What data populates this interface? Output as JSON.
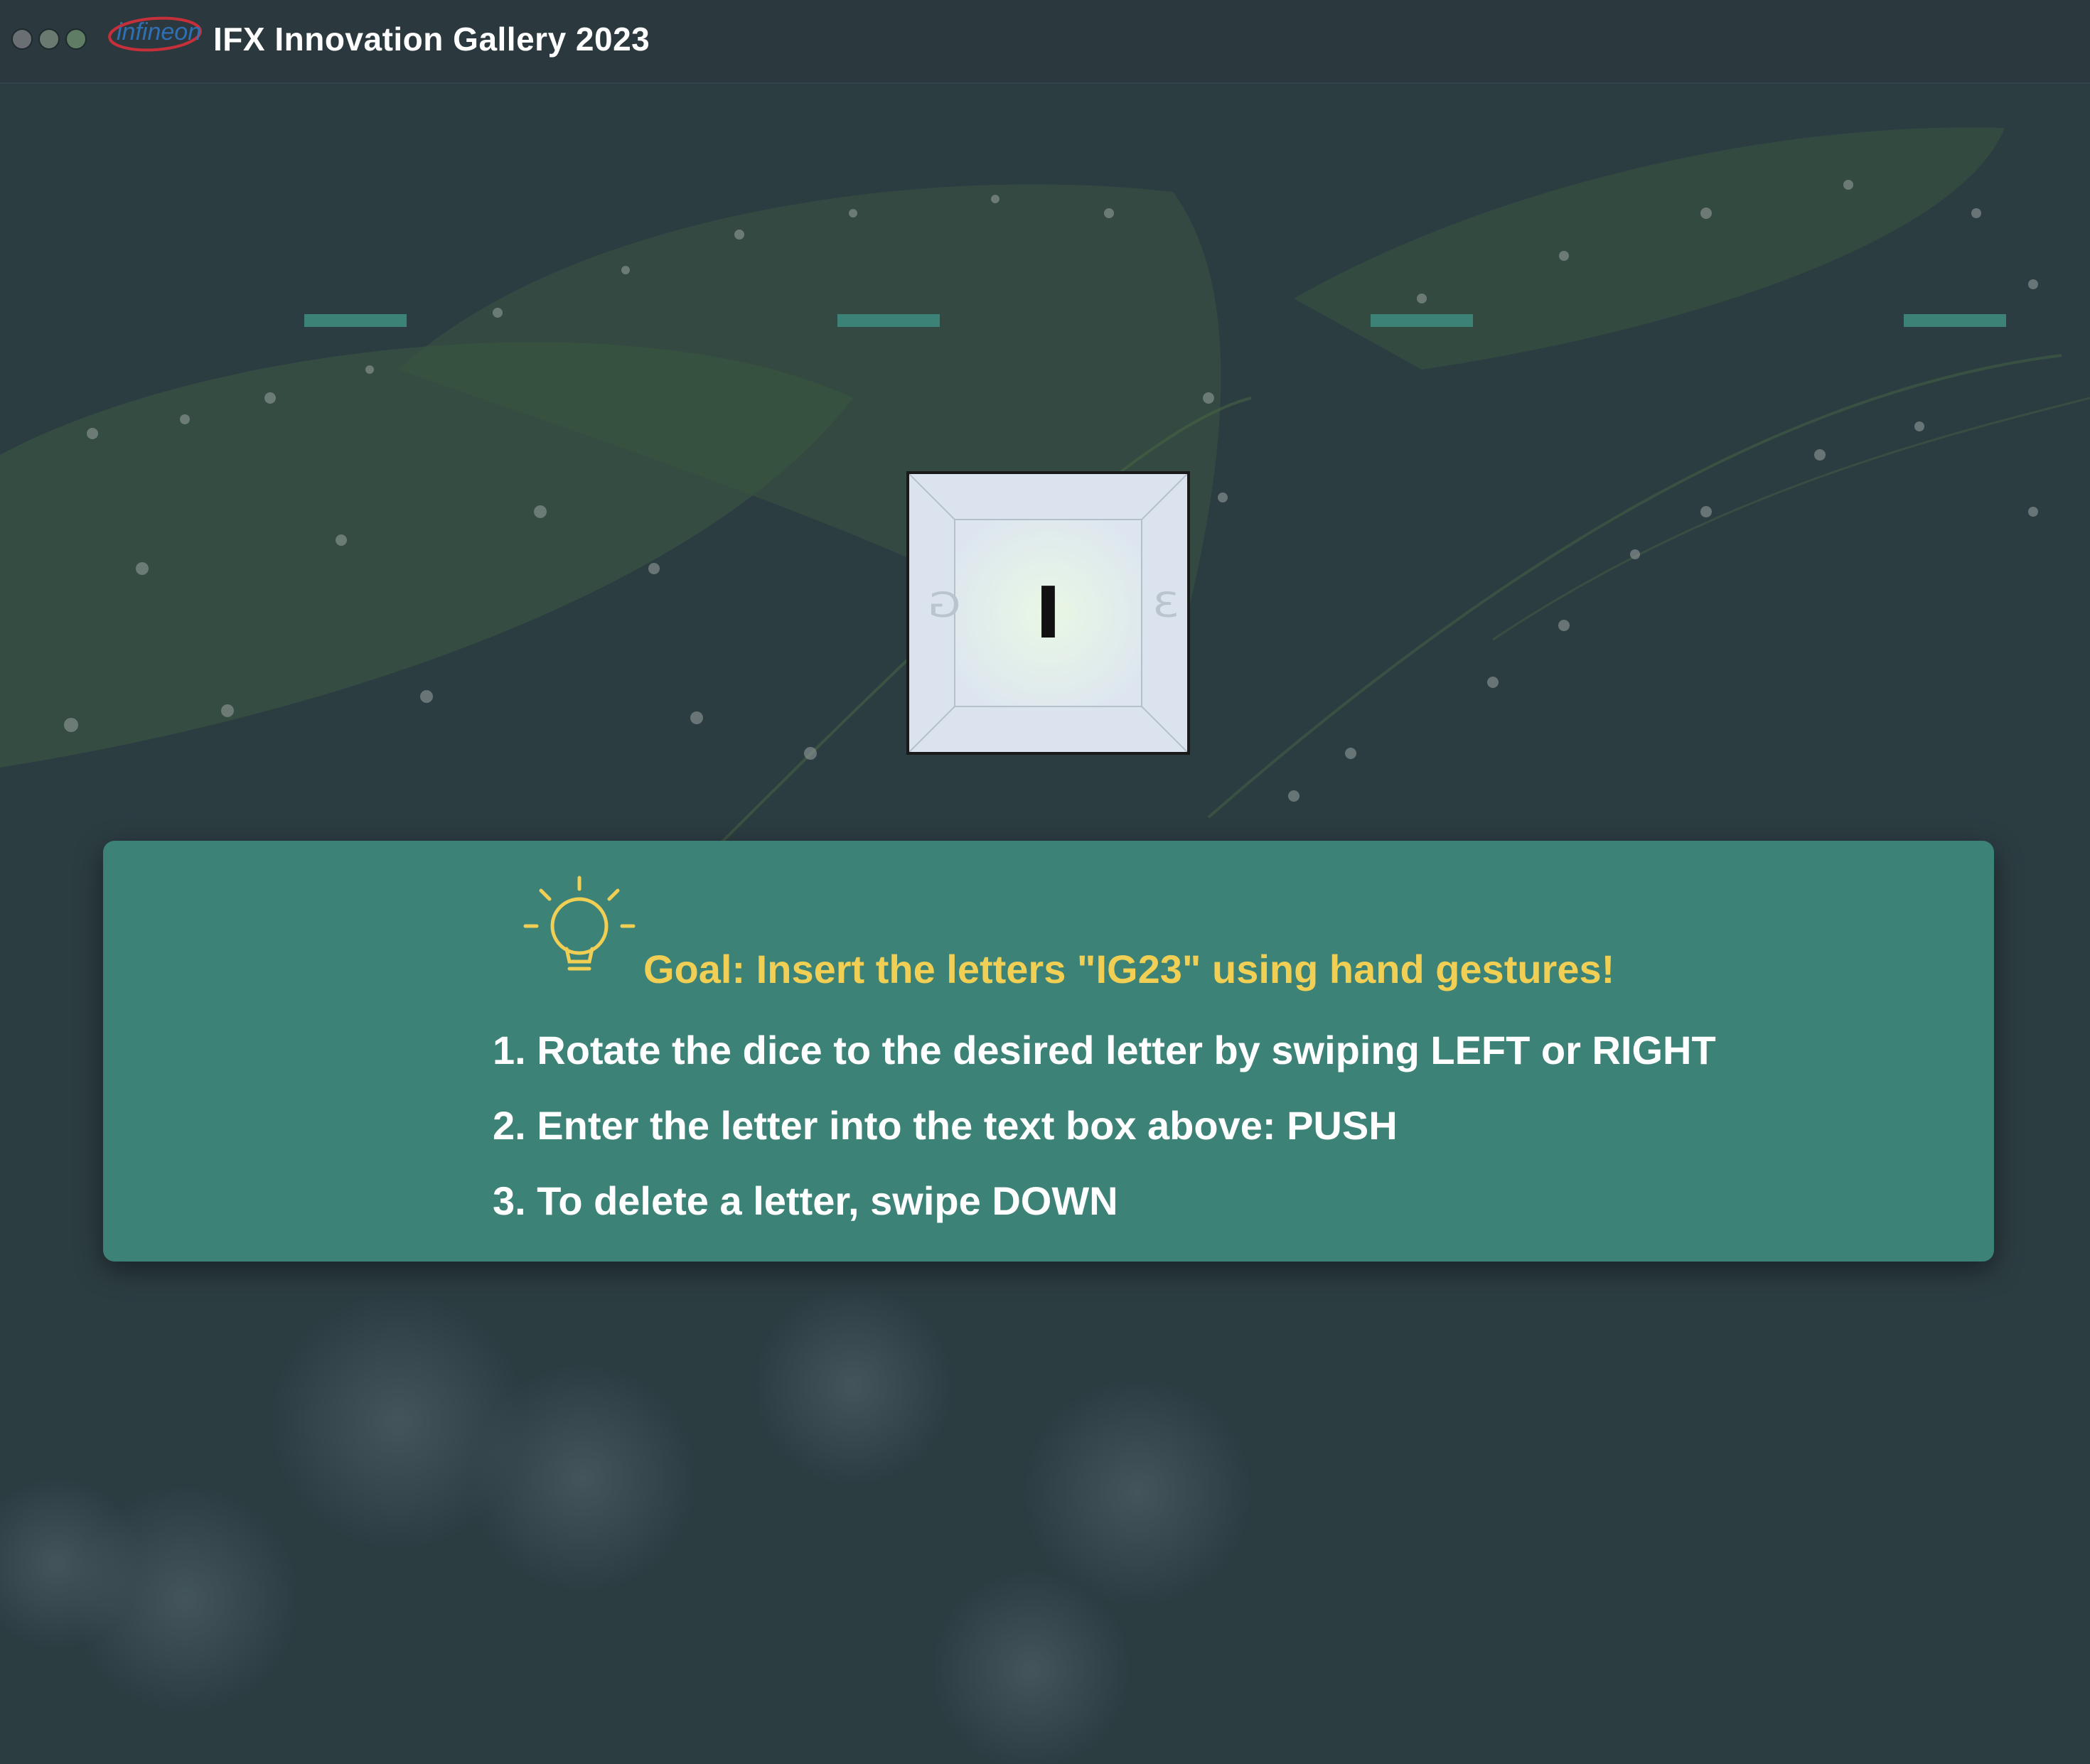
{
  "window": {
    "title": "IFX Innovation Gallery 2023",
    "logo_text": "infineon",
    "traffic_lights": [
      "#6a6f73",
      "#6a7a70",
      "#5e7d64"
    ]
  },
  "slots": [
    "",
    "",
    "",
    ""
  ],
  "dice": {
    "front_letter": "I",
    "left_letter": "G",
    "right_letter": "3"
  },
  "instructions": {
    "goal": "Goal: Insert the letters \"IG23\" using hand gestures!",
    "steps": [
      "1. Rotate the dice to the desired letter by swiping LEFT or RIGHT",
      "2. Enter the letter into the text box above: PUSH",
      "3. To delete a letter, swipe DOWN"
    ]
  },
  "colors": {
    "accent": "#3c8276",
    "goal": "#f1cf55",
    "background": "#2c3d42"
  }
}
